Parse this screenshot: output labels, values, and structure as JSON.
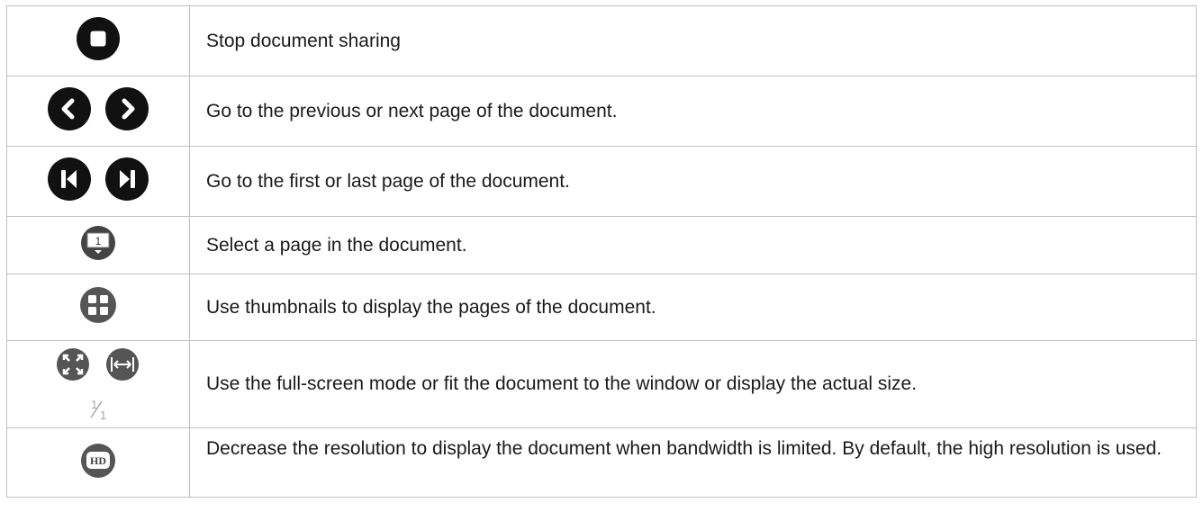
{
  "rows": [
    {
      "description": "Stop document sharing",
      "icons": [
        "stop-icon"
      ]
    },
    {
      "description": "Go to the previous or next page of the document.",
      "icons": [
        "chevron-left-icon",
        "chevron-right-icon"
      ]
    },
    {
      "description": "Go to the first or last page of the document.",
      "icons": [
        "skip-to-first-icon",
        "skip-to-last-icon"
      ]
    },
    {
      "description": "Select a page in the document.",
      "icons": [
        "page-select-icon"
      ],
      "page_number": "1"
    },
    {
      "description": "Use thumbnails to display the pages of the document.",
      "icons": [
        "thumbnails-grid-icon"
      ]
    },
    {
      "description": "Use the full-screen mode or fit the document to the window or display the actual size.",
      "icons": [
        "fullscreen-icon",
        "fit-width-icon",
        "actual-size-icon"
      ]
    },
    {
      "description": "Decrease the resolution to display the document when bandwidth is limited. By default, the high resolution is used.",
      "icons": [
        "hd-icon"
      ],
      "hd_label": "HD"
    }
  ],
  "colors": {
    "dark_icon": "#111111",
    "gray_icon": "#555555",
    "border": "#bfbfbf",
    "text": "#1a1a1a"
  }
}
